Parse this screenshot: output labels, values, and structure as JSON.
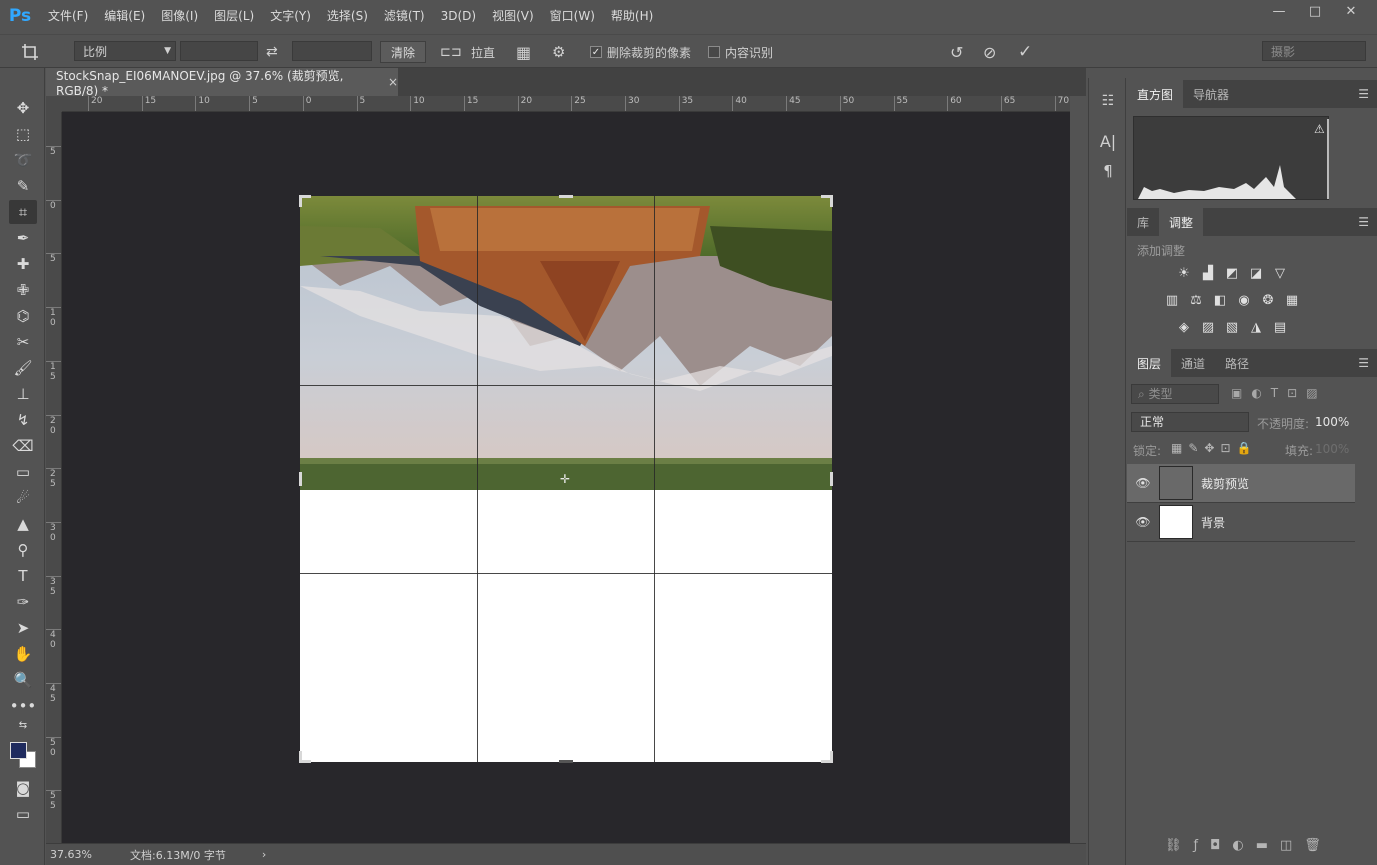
{
  "app": {
    "logo": "Ps"
  },
  "menu": [
    "文件(F)",
    "编辑(E)",
    "图像(I)",
    "图层(L)",
    "文字(Y)",
    "选择(S)",
    "滤镜(T)",
    "3D(D)",
    "视图(V)",
    "窗口(W)",
    "帮助(H)"
  ],
  "window_controls": {
    "minimize": "—",
    "maximize": "□",
    "close": "✕"
  },
  "options": {
    "ratio_select": "比例",
    "clear_label": "清除",
    "straighten_label": "拉直",
    "delete_cropped_label": "删除裁剪的像素",
    "delete_cropped_checked": true,
    "content_aware_label": "内容识别",
    "content_aware_checked": false,
    "workspace": "摄影"
  },
  "document": {
    "tab_title": "StockSnap_EI06MANOEV.jpg @ 37.6% (裁剪预览, RGB/8) *",
    "close_icon": "×"
  },
  "rulers": {
    "h_labels": [
      "20",
      "15",
      "10",
      "5",
      "0",
      "5",
      "10",
      "15",
      "20",
      "25",
      "30",
      "35",
      "40",
      "45",
      "50",
      "55",
      "60",
      "65",
      "70"
    ],
    "v_labels": [
      "5",
      "0",
      "5",
      "1 0",
      "1 5",
      "2 0",
      "2 5",
      "3 0",
      "3 5",
      "4 0",
      "4 5",
      "5 0",
      "5 5"
    ]
  },
  "right_panels": {
    "top_tabs": [
      "直方图",
      "导航器"
    ],
    "mid_tabs": [
      "库",
      "调整"
    ],
    "adjust_title": "添加调整",
    "layer_tabs": [
      "图层",
      "通道",
      "路径"
    ],
    "layer_filter": "类型",
    "blend_mode": "正常",
    "opacity_label": "不透明度:",
    "opacity_value": "100%",
    "lock_label": "锁定:",
    "fill_label": "填充:",
    "fill_value": "100%",
    "layers": [
      {
        "name": "裁剪预览",
        "selected": true
      },
      {
        "name": "背景",
        "selected": false
      }
    ]
  },
  "status": {
    "zoom": "37.63%",
    "doc_info": "文档:6.13M/0 字节"
  }
}
